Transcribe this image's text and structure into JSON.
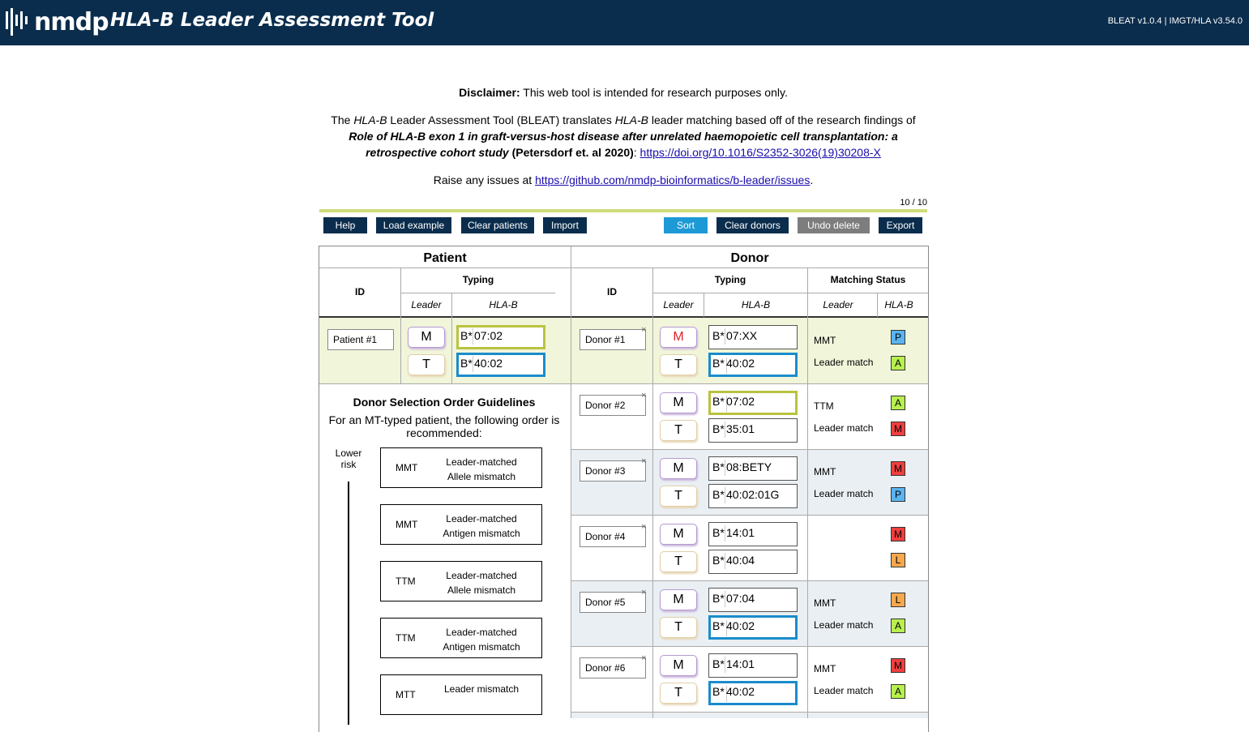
{
  "header": {
    "logo_text": "nmdp",
    "title": "HLA-B Leader Assessment Tool",
    "version": "BLEAT v1.0.4 | IMGT/HLA v3.54.0"
  },
  "intro": {
    "disclaimer_label": "Disclaimer:",
    "disclaimer_text": " This web tool is intended for research purposes only.",
    "desc_1": "The ",
    "desc_hlab_1": "HLA-B",
    "desc_2": " Leader Assessment Tool (BLEAT) translates ",
    "desc_hlab_2": "HLA-B",
    "desc_3": " leader matching based off of the research findings of",
    "paper_title": "Role of HLA-B exon 1 in graft-versus-host disease after unrelated haemopoietic cell transplantation: a retrospective cohort study",
    "paper_cite": " (Petersdorf et. al 2020)",
    "colon": ": ",
    "doi_link": "https://doi.org/10.1016/S2352-3026(19)30208-X",
    "issues_text": "Raise any issues at ",
    "issues_link": "https://github.com/nmdp-bioinformatics/b-leader/issues",
    "issues_end": "."
  },
  "counter": "10 / 10",
  "toolbar": {
    "help": "Help",
    "load_example": "Load example",
    "clear_patients": "Clear patients",
    "import": "Import",
    "sort": "Sort",
    "clear_donors": "Clear donors",
    "undo_delete": "Undo delete",
    "export": "Export"
  },
  "table_headers": {
    "patient": "Patient",
    "donor": "Donor",
    "id": "ID",
    "typing": "Typing",
    "matching_status": "Matching Status",
    "leader": "Leader",
    "hlab": "HLA-B"
  },
  "patient": {
    "id": "Patient #1",
    "leader_1": "M",
    "leader_2": "T",
    "prefix": "B*",
    "allele_1": "07:02",
    "allele_2": "40:02"
  },
  "donors": [
    {
      "id": "Donor #1",
      "leader_1": "M",
      "leader_2": "T",
      "allele_1": "07:XX",
      "allele_2": "40:02",
      "status_1": "MMT",
      "status_2": "Leader match",
      "badge_1": "P",
      "badge_2": "A"
    },
    {
      "id": "Donor #2",
      "leader_1": "M",
      "leader_2": "T",
      "allele_1": "07:02",
      "allele_2": "35:01",
      "status_1": "TTM",
      "status_2": "Leader match",
      "badge_1": "A",
      "badge_2": "M"
    },
    {
      "id": "Donor #3",
      "leader_1": "M",
      "leader_2": "T",
      "allele_1": "08:BETY",
      "allele_2": "40:02:01G",
      "status_1": "MMT",
      "status_2": "Leader match",
      "badge_1": "M",
      "badge_2": "P"
    },
    {
      "id": "Donor #4",
      "leader_1": "M",
      "leader_2": "T",
      "allele_1": "14:01",
      "allele_2": "40:04",
      "status_1": "",
      "status_2": "",
      "badge_1": "M",
      "badge_2": "L"
    },
    {
      "id": "Donor #5",
      "leader_1": "M",
      "leader_2": "T",
      "allele_1": "07:04",
      "allele_2": "40:02",
      "status_1": "MMT",
      "status_2": "Leader match",
      "badge_1": "L",
      "badge_2": "A"
    },
    {
      "id": "Donor #6",
      "leader_1": "M",
      "leader_2": "T",
      "allele_1": "14:01",
      "allele_2": "40:02",
      "status_1": "MMT",
      "status_2": "Leader match",
      "badge_1": "M",
      "badge_2": "A"
    }
  ],
  "delete_glyph": "×",
  "guidelines": {
    "title": "Donor Selection Order Guidelines",
    "subtitle": "For an MT-typed patient, the following order is recommended:",
    "risk_label": "Lower risk",
    "items": [
      {
        "code": "MMT",
        "line_1": "Leader-matched",
        "line_2": "Allele mismatch"
      },
      {
        "code": "MMT",
        "line_1": "Leader-matched",
        "line_2": "Antigen mismatch"
      },
      {
        "code": "TTM",
        "line_1": "Leader-matched",
        "line_2": "Allele mismatch"
      },
      {
        "code": "TTM",
        "line_1": "Leader-matched",
        "line_2": "Antigen mismatch"
      },
      {
        "code": "MTT",
        "line_1": "Leader mismatch",
        "line_2": ""
      }
    ]
  },
  "colors": {
    "header_bg": "#0b2d4d",
    "patient_row_bg": "#f1f5da",
    "alt_row_bg": "#eaeff3",
    "sort_button": "#1d9ad6",
    "undo_button": "#7d7d7d",
    "badge_P": "#5ab4ef",
    "badge_A": "#b8ef4e",
    "badge_M": "#ef3f3f",
    "badge_L": "#f5a84d"
  }
}
